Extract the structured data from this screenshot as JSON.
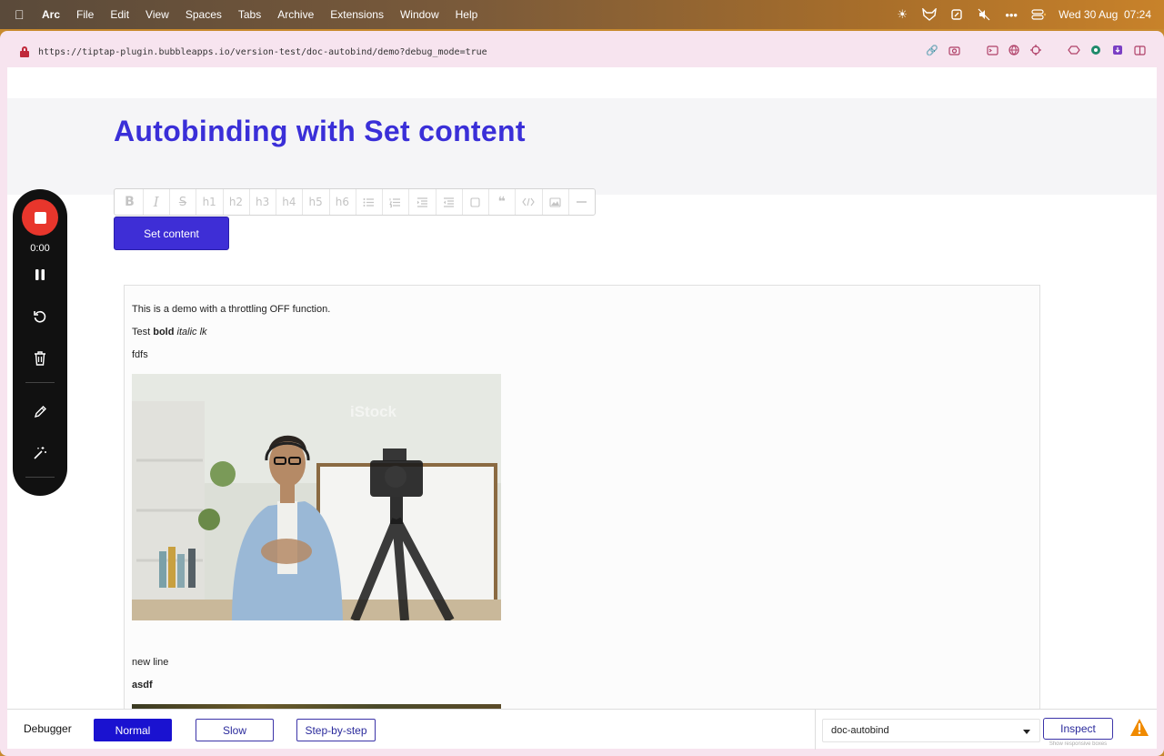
{
  "menubar": {
    "app": "Arc",
    "items": [
      "File",
      "Edit",
      "View",
      "Spaces",
      "Tabs",
      "Archive",
      "Extensions",
      "Window",
      "Help"
    ],
    "clock": "Wed 30 Aug  07:24"
  },
  "browser": {
    "url": "https://tiptap-plugin.bubbleapps.io/version-test/doc-autobind/demo?debug_mode=true"
  },
  "page": {
    "title": "Autobinding with Set content",
    "toolbar": {
      "bold": "B",
      "italic": "I",
      "strike": "S",
      "headings": [
        "h1",
        "h2",
        "h3",
        "h4",
        "h5",
        "h6"
      ]
    },
    "set_content_label": "Set content"
  },
  "editor": {
    "line1": "This is a demo with a throttling OFF function.",
    "line2_prefix": "Test ",
    "line2_bold": "bold",
    "line2_italic": "italic lk",
    "line3": "fdfs",
    "photo_watermark": "iStock",
    "line4": "new line",
    "line5": "asdf"
  },
  "recorder": {
    "time": "0:00"
  },
  "debugger": {
    "label": "Debugger",
    "modes": [
      "Normal",
      "Slow",
      "Step-by-step"
    ],
    "active_mode": "Normal",
    "page_select": "doc-autobind",
    "inspect_label": "Inspect",
    "inspect_sub": "Show responsive boxes"
  },
  "colors": {
    "accent": "#3a2fd8",
    "record": "#e8362c",
    "warning": "#f08a00"
  }
}
